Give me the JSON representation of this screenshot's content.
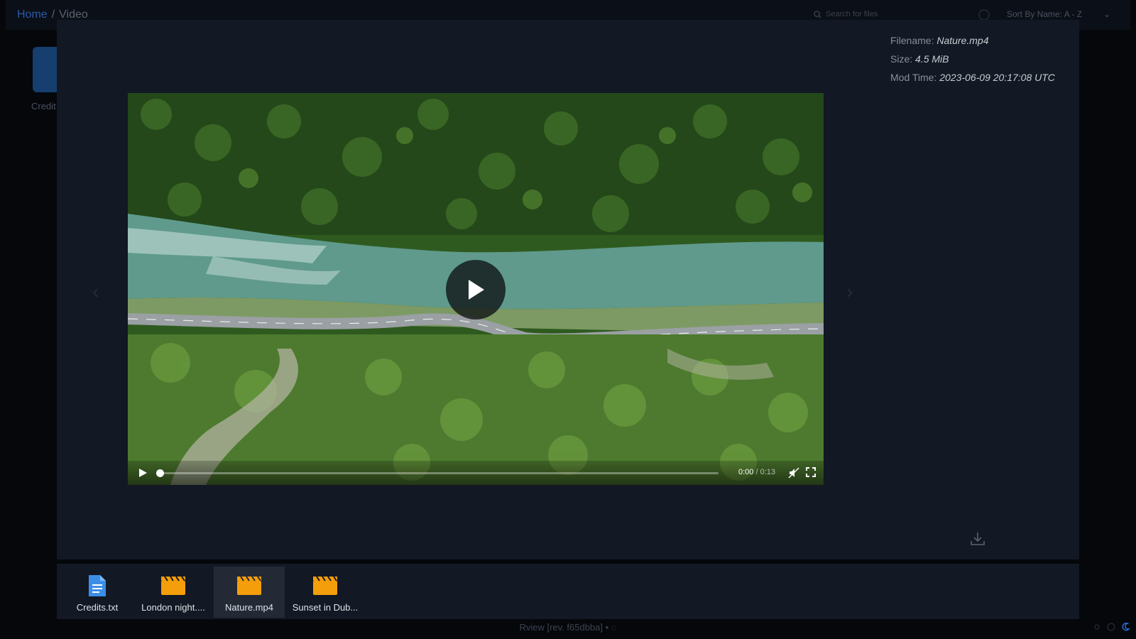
{
  "breadcrumb": {
    "home": "Home",
    "separator": "/",
    "current": "Video"
  },
  "search": {
    "placeholder": "Search for files"
  },
  "sort": {
    "label": "Sort By Name: A - Z"
  },
  "background_file": {
    "label": "Credit"
  },
  "info": {
    "filename_label": "Filename:",
    "filename": "Nature.mp4",
    "size_label": "Size:",
    "size": "4.5 MiB",
    "modtime_label": "Mod Time:",
    "modtime": "2023-06-09 20:17:08 UTC"
  },
  "player": {
    "current_time": "0:00",
    "duration": "0:13",
    "progress": 0.0,
    "muted": true
  },
  "strip": [
    {
      "label": "Credits.txt",
      "icon": "document-icon",
      "color": "#3b8ee8"
    },
    {
      "label": "London night....",
      "icon": "clapperboard-icon",
      "color": "#f59e0b"
    },
    {
      "label": "Nature.mp4",
      "icon": "clapperboard-icon",
      "color": "#f59e0b",
      "selected": true
    },
    {
      "label": "Sunset in Dub...",
      "icon": "clapperboard-icon",
      "color": "#f59e0b"
    }
  ],
  "footer": {
    "text": "Rview [rev. f65dbba] •"
  }
}
